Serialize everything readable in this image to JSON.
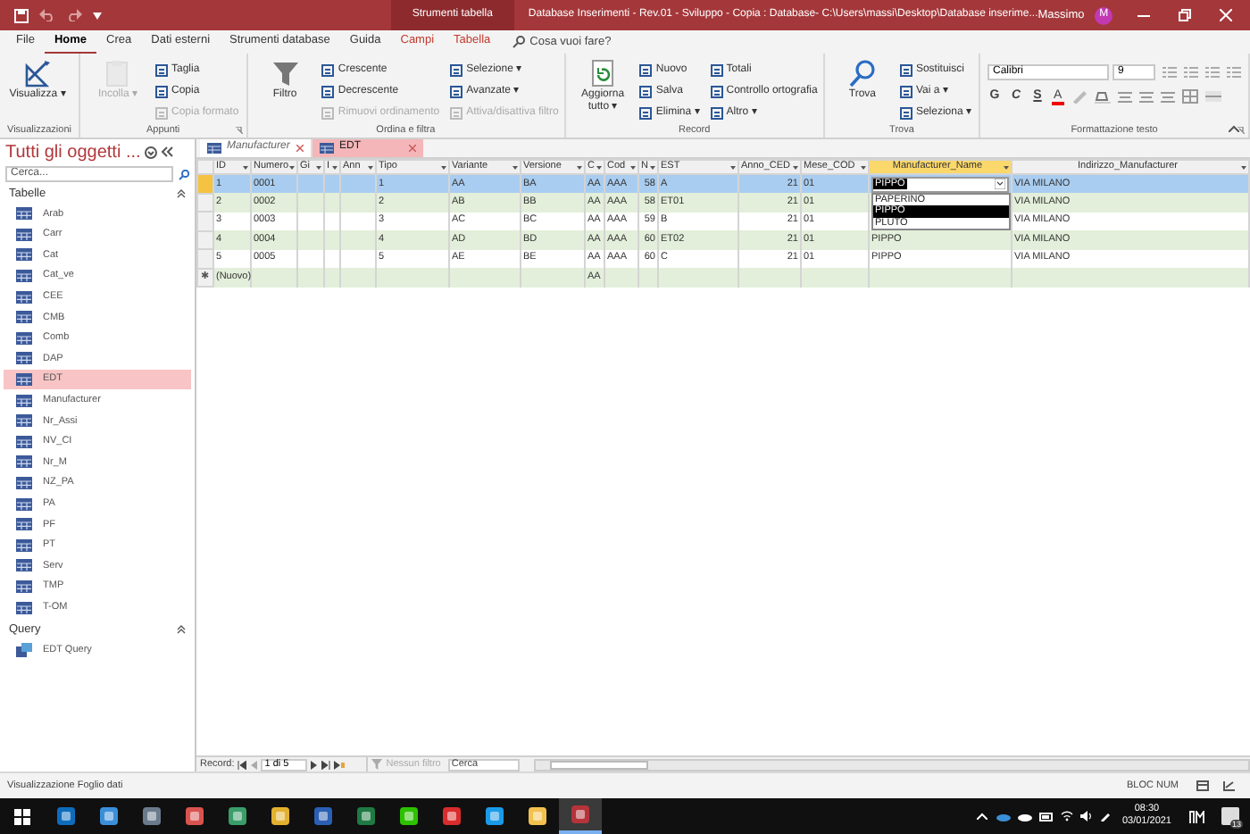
{
  "window": {
    "context_title": "Strumenti tabella",
    "title": "Database Inserimenti - Rev.01 - Sviluppo - Copia : Database- C:\\Users\\massi\\Desktop\\Database inserime...",
    "user": "Massimo",
    "avatar": "M"
  },
  "menu_tabs": [
    {
      "label": "File",
      "selected": false,
      "contextual": false
    },
    {
      "label": "Home",
      "selected": true,
      "contextual": false
    },
    {
      "label": "Crea",
      "selected": false,
      "contextual": false
    },
    {
      "label": "Dati esterni",
      "selected": false,
      "contextual": false
    },
    {
      "label": "Strumenti database",
      "selected": false,
      "contextual": false
    },
    {
      "label": "Guida",
      "selected": false,
      "contextual": false
    },
    {
      "label": "Campi",
      "selected": false,
      "contextual": true
    },
    {
      "label": "Tabella",
      "selected": false,
      "contextual": true
    }
  ],
  "tell_me": "Cosa vuoi fare?",
  "ribbon": [
    {
      "label": "Visualizzazioni",
      "kind": "commands",
      "launcher": false,
      "items": [
        {
          "kind": "large",
          "label": "Visualizza ▾",
          "disabled": false
        }
      ]
    },
    {
      "label": "Appunti",
      "kind": "commands",
      "launcher": true,
      "items": [
        {
          "kind": "large",
          "label": "Incolla ▾",
          "disabled": true
        },
        {
          "kind": "small",
          "label": "Taglia",
          "disabled": false
        },
        {
          "kind": "small",
          "label": "Copia",
          "disabled": false
        },
        {
          "kind": "small",
          "label": "Copia formato",
          "disabled": true
        }
      ]
    },
    {
      "label": "Ordina e filtra",
      "kind": "commands",
      "launcher": false,
      "items": [
        {
          "kind": "large",
          "label": "Filtro",
          "disabled": false
        },
        {
          "kind": "small",
          "label": "Crescente",
          "disabled": false
        },
        {
          "kind": "small",
          "label": "Decrescente",
          "disabled": false
        },
        {
          "kind": "small",
          "label": "Rimuovi ordinamento",
          "disabled": true
        },
        {
          "kind": "small",
          "label": "Selezione ▾",
          "disabled": false
        },
        {
          "kind": "small",
          "label": "Avanzate ▾",
          "disabled": false
        },
        {
          "kind": "small",
          "label": "Attiva/disattiva filtro",
          "disabled": true
        }
      ]
    },
    {
      "label": "Record",
      "kind": "commands",
      "launcher": false,
      "items": [
        {
          "kind": "large",
          "label": "Aggiorna tutto ▾",
          "disabled": false
        },
        {
          "kind": "small",
          "label": "Nuovo",
          "disabled": false
        },
        {
          "kind": "small",
          "label": "Salva",
          "disabled": false
        },
        {
          "kind": "small",
          "label": "Elimina ▾",
          "disabled": false
        },
        {
          "kind": "small",
          "label": "Totali",
          "disabled": false
        },
        {
          "kind": "small",
          "label": "Controllo ortografia",
          "disabled": false
        },
        {
          "kind": "small",
          "label": "Altro ▾",
          "disabled": false
        }
      ]
    },
    {
      "label": "Trova",
      "kind": "commands",
      "launcher": false,
      "items": [
        {
          "kind": "large",
          "label": "Trova",
          "disabled": false
        },
        {
          "kind": "small",
          "label": "Sostituisci",
          "disabled": false
        },
        {
          "kind": "small",
          "label": "Vai a ▾",
          "disabled": false
        },
        {
          "kind": "small",
          "label": "Seleziona ▾",
          "disabled": false
        }
      ]
    },
    {
      "label": "Formattazione testo",
      "kind": "font",
      "launcher": true,
      "font": "Calibri",
      "size": "9",
      "styles": [
        "G",
        "C",
        "S"
      ],
      "color_letter": "A"
    }
  ],
  "nav": {
    "title": "Tutti gli oggetti ...",
    "search_placeholder": "Cerca...",
    "sections": [
      {
        "label": "Tabelle",
        "kind": "table",
        "items": [
          {
            "label": "Arab",
            "selected": false
          },
          {
            "label": "Carr",
            "selected": false
          },
          {
            "label": "Cat",
            "selected": false
          },
          {
            "label": "Cat_ve",
            "selected": false
          },
          {
            "label": "CEE",
            "selected": false
          },
          {
            "label": "CMB",
            "selected": false
          },
          {
            "label": "Comb",
            "selected": false
          },
          {
            "label": "DAP",
            "selected": false
          },
          {
            "label": "EDT",
            "selected": true
          },
          {
            "label": "Manufacturer",
            "selected": false
          },
          {
            "label": "Nr_Assi",
            "selected": false
          },
          {
            "label": "NV_CI",
            "selected": false
          },
          {
            "label": "Nr_M",
            "selected": false
          },
          {
            "label": "NZ_PA",
            "selected": false
          },
          {
            "label": "PA",
            "selected": false
          },
          {
            "label": "PF",
            "selected": false
          },
          {
            "label": "PT",
            "selected": false
          },
          {
            "label": "Serv",
            "selected": false
          },
          {
            "label": "TMP",
            "selected": false
          },
          {
            "label": "T-OM",
            "selected": false
          }
        ]
      },
      {
        "label": "Query",
        "kind": "query",
        "items": [
          {
            "label": "EDT Query",
            "selected": false
          }
        ]
      }
    ]
  },
  "doc_tabs": [
    {
      "label": "Manufacturer",
      "selected": false
    },
    {
      "label": "EDT",
      "selected": true
    }
  ],
  "datasheet": {
    "columns": [
      {
        "label": "ID",
        "right_aligned": false,
        "selected": false
      },
      {
        "label": "Numero",
        "right_aligned": false,
        "selected": false
      },
      {
        "label": "Gi",
        "selected": false
      },
      {
        "label": "I",
        "selected": false
      },
      {
        "label": "Ann",
        "selected": false
      },
      {
        "label": "Tipo",
        "right_aligned": false,
        "selected": false
      },
      {
        "label": "Variante",
        "right_aligned": false,
        "selected": false
      },
      {
        "label": "Versione",
        "right_aligned": false,
        "selected": false
      },
      {
        "label": "C",
        "right_aligned": false,
        "selected": false
      },
      {
        "label": "Cod",
        "right_aligned": false,
        "selected": false
      },
      {
        "label": "N",
        "right_aligned": true,
        "selected": false
      },
      {
        "label": "EST",
        "right_aligned": false,
        "selected": false
      },
      {
        "label": "Anno_CED",
        "right_aligned": true,
        "selected": false
      },
      {
        "label": "Mese_COD",
        "right_aligned": false,
        "selected": false
      },
      {
        "label": "Manufacturer_Name",
        "right_aligned": false,
        "selected": true
      },
      {
        "label": "Indirizzo_Manufacturer",
        "right_aligned": false,
        "selected": false
      }
    ],
    "rows": [
      {
        "kind": "record",
        "selected": true,
        "cells": [
          "1",
          "0001",
          null,
          null,
          null,
          "1",
          "AA",
          "BA",
          "AA",
          "AAA",
          "58",
          "A",
          "21",
          "01",
          "PIPPO",
          "VIA MILANO"
        ],
        "combo": {
          "expanded": true,
          "options": [
            {
              "label": "PAPERINO",
              "selected": false
            },
            {
              "label": "PIPPO",
              "selected": true
            },
            {
              "label": "PLUTO",
              "selected": false
            }
          ]
        }
      },
      {
        "kind": "record",
        "selected": false,
        "cells": [
          "2",
          "0002",
          null,
          null,
          null,
          "2",
          "AB",
          "BB",
          "AA",
          "AAA",
          "58",
          "ET01",
          "21",
          "01",
          null,
          "VIA MILANO"
        ]
      },
      {
        "kind": "record",
        "selected": false,
        "cells": [
          "3",
          "0003",
          null,
          null,
          null,
          "3",
          "AC",
          "BC",
          "AA",
          "AAA",
          "59",
          "B",
          "21",
          "01",
          null,
          "VIA MILANO"
        ]
      },
      {
        "kind": "record",
        "selected": false,
        "cells": [
          "4",
          "0004",
          null,
          null,
          null,
          "4",
          "AD",
          "BD",
          "AA",
          "AAA",
          "60",
          "ET02",
          "21",
          "01",
          "PIPPO",
          "VIA MILANO"
        ]
      },
      {
        "kind": "record",
        "selected": false,
        "cells": [
          "5",
          "0005",
          null,
          null,
          null,
          "5",
          "AE",
          "BE",
          "AA",
          "AAA",
          "60",
          "C",
          "21",
          "01",
          "PIPPO",
          "VIA MILANO"
        ]
      },
      {
        "kind": "new",
        "selected": false,
        "marker": "✱",
        "cells": [
          "(Nuovo)",
          null,
          null,
          null,
          null,
          null,
          null,
          null,
          "AA",
          null,
          null,
          null,
          null,
          null,
          null,
          null
        ]
      }
    ]
  },
  "record_nav": {
    "label": "Record:",
    "position": "1 di 5",
    "filter": "Nessun filtro",
    "search": "Cerca"
  },
  "status": {
    "text": "Visualizzazione Foglio dati",
    "indicator": "BLOC NUM"
  },
  "taskbar": {
    "apps": [
      {
        "selected": false
      },
      {
        "selected": false
      },
      {
        "selected": false
      },
      {
        "selected": false
      },
      {
        "selected": false
      },
      {
        "selected": false
      },
      {
        "selected": false
      },
      {
        "selected": false
      },
      {
        "selected": false
      },
      {
        "selected": false
      },
      {
        "selected": false
      },
      {
        "selected": false
      },
      {
        "selected": true
      }
    ],
    "time": "08:30",
    "date": "03/01/2021",
    "notifications": "13"
  }
}
